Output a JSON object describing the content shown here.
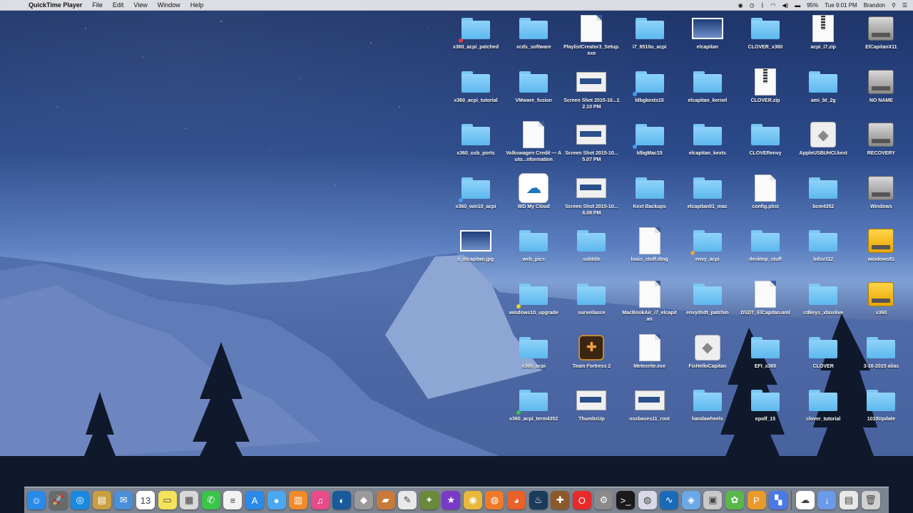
{
  "menubar": {
    "app_name": "QuickTime Player",
    "menus": [
      "File",
      "Edit",
      "View",
      "Window",
      "Help"
    ],
    "battery": "95%",
    "clock": "Tue 9:01 PM",
    "user": "Brandon"
  },
  "desktop": {
    "icons": [
      {
        "label": "x360_acpi_patched",
        "type": "folder",
        "col": 0,
        "row": 0,
        "tag": "#e43b3b"
      },
      {
        "label": "x360_acpi_tutorial",
        "type": "folder",
        "col": 0,
        "row": 1
      },
      {
        "label": "x360_usb_ports",
        "type": "folder",
        "col": 0,
        "row": 2
      },
      {
        "label": "x360_win10_acpi",
        "type": "folder",
        "col": 0,
        "row": 3,
        "tag": "#4a9ae8"
      },
      {
        "label": "z_elcapitan.jpg",
        "type": "shot-dark",
        "col": 0,
        "row": 4
      },
      {
        "label": "xcds_software",
        "type": "folder",
        "col": 1,
        "row": 0
      },
      {
        "label": "VMware_fusion",
        "type": "folder",
        "col": 1,
        "row": 1
      },
      {
        "label": "Volkswagen Credit — Auto...nformation",
        "type": "doc",
        "col": 1,
        "row": 2
      },
      {
        "label": "WD My Cloud",
        "type": "cloud",
        "col": 1,
        "row": 3
      },
      {
        "label": "web_pics",
        "type": "folder",
        "col": 1,
        "row": 4
      },
      {
        "label": "windows10_upgrade",
        "type": "folder",
        "col": 1,
        "row": 5,
        "tag": "#e8d23b"
      },
      {
        "label": "x360_acpi",
        "type": "folder",
        "col": 1,
        "row": 6
      },
      {
        "label": "x360_acpi_term4352",
        "type": "folder",
        "col": 1,
        "row": 7,
        "tag": "#3bc44a"
      },
      {
        "label": "PlaylistCreator3_Setup.exe",
        "type": "doc",
        "col": 2,
        "row": 0
      },
      {
        "label": "Screen Shot 2015-10...12.10 PM",
        "type": "shot",
        "col": 2,
        "row": 1
      },
      {
        "label": "Screen Shot 2015-10...5.07 PM",
        "type": "shot",
        "col": 2,
        "row": 2
      },
      {
        "label": "Screen Shot 2015-10...6.08 PM",
        "type": "shot",
        "col": 2,
        "row": 3
      },
      {
        "label": "subtitle",
        "type": "folder",
        "col": 2,
        "row": 4
      },
      {
        "label": "surveilance",
        "type": "folder",
        "col": 2,
        "row": 5
      },
      {
        "label": "Team Fortress 2",
        "type": "tf2",
        "col": 2,
        "row": 6
      },
      {
        "label": "ThumbsUp",
        "type": "shot",
        "col": 2,
        "row": 7
      },
      {
        "label": "i7_6510u_acpi",
        "type": "folder",
        "col": 3,
        "row": 0
      },
      {
        "label": "ldbgkexts15",
        "type": "folder",
        "col": 3,
        "row": 1,
        "tag": "#4a9ae8"
      },
      {
        "label": "ldbgMac15",
        "type": "folder",
        "col": 3,
        "row": 2,
        "tag": "#4a9ae8"
      },
      {
        "label": "Kext Backups",
        "type": "folder",
        "col": 3,
        "row": 3
      },
      {
        "label": "louis_stuff.dmg",
        "type": "doc",
        "col": 3,
        "row": 4
      },
      {
        "label": "MacBookAir_i7_elcapitan",
        "type": "doc",
        "col": 3,
        "row": 5
      },
      {
        "label": "Meteorite.exe",
        "type": "doc",
        "col": 3,
        "row": 6
      },
      {
        "label": "osxbases11_root",
        "type": "shot",
        "col": 3,
        "row": 7
      },
      {
        "label": "elcapitan",
        "type": "shot-dark",
        "col": 4,
        "row": 0
      },
      {
        "label": "elcapitan_kernel",
        "type": "folder",
        "col": 4,
        "row": 1
      },
      {
        "label": "elcapitan_kexts",
        "type": "folder",
        "col": 4,
        "row": 2
      },
      {
        "label": "elcapitan01_mac",
        "type": "folder",
        "col": 4,
        "row": 3
      },
      {
        "label": "envy_acpi",
        "type": "folder",
        "col": 4,
        "row": 4,
        "tag": "#e8a53b"
      },
      {
        "label": "envydsdt_patchin",
        "type": "folder",
        "col": 4,
        "row": 5
      },
      {
        "label": "FixHelloCapitan",
        "type": "pkg",
        "col": 4,
        "row": 6
      },
      {
        "label": "handawheels",
        "type": "folder",
        "col": 4,
        "row": 7
      },
      {
        "label": "CLOVER_x360",
        "type": "folder",
        "col": 5,
        "row": 0
      },
      {
        "label": "CLOVER.zip",
        "type": "zip",
        "col": 5,
        "row": 1
      },
      {
        "label": "CLOVERenvy",
        "type": "folder",
        "col": 5,
        "row": 2
      },
      {
        "label": "config.plist",
        "type": "doc",
        "col": 5,
        "row": 3
      },
      {
        "label": "desktop_stuff",
        "type": "folder",
        "col": 5,
        "row": 4
      },
      {
        "label": "DSDT_ElCapitan.aml",
        "type": "doc",
        "col": 5,
        "row": 5
      },
      {
        "label": "EFI_x360",
        "type": "folder",
        "col": 5,
        "row": 6
      },
      {
        "label": "epolf_15",
        "type": "folder",
        "col": 5,
        "row": 7
      },
      {
        "label": "acpi_i7.zip",
        "type": "zip",
        "col": 6,
        "row": 0
      },
      {
        "label": "ami_bt_2g",
        "type": "folder",
        "col": 6,
        "row": 1
      },
      {
        "label": "AppleUSBUHCI.kext",
        "type": "pkg",
        "col": 6,
        "row": 2
      },
      {
        "label": "bcm4352",
        "type": "folder",
        "col": 6,
        "row": 3
      },
      {
        "label": "bdsv312",
        "type": "folder",
        "col": 6,
        "row": 4
      },
      {
        "label": "cdkeys_xboxlive",
        "type": "folder",
        "col": 6,
        "row": 5
      },
      {
        "label": "CLOVER",
        "type": "folder",
        "col": 6,
        "row": 6
      },
      {
        "label": "clover_tutorial",
        "type": "folder",
        "col": 6,
        "row": 7
      },
      {
        "label": "ElCapitanX11",
        "type": "disk",
        "col": 7,
        "row": 0
      },
      {
        "label": "NO NAME",
        "type": "disk",
        "col": 7,
        "row": 1
      },
      {
        "label": "RECOVERY",
        "type": "disk",
        "col": 7,
        "row": 2
      },
      {
        "label": "Windows",
        "type": "disk",
        "col": 7,
        "row": 3
      },
      {
        "label": "windows81",
        "type": "disk-yellow",
        "col": 7,
        "row": 4
      },
      {
        "label": "x360",
        "type": "disk-yellow",
        "col": 7,
        "row": 5
      },
      {
        "label": "3-16-2015 alias",
        "type": "folder",
        "col": 7,
        "row": 6
      },
      {
        "label": "1010Update",
        "type": "folder",
        "col": 7,
        "row": 7
      }
    ]
  },
  "dock": {
    "items": [
      {
        "name": "finder-icon",
        "color": "#2a8ae8",
        "glyph": "☺"
      },
      {
        "name": "launchpad-icon",
        "color": "#6a6a6a",
        "glyph": "🚀"
      },
      {
        "name": "safari-icon",
        "color": "#1a8ae0",
        "glyph": "◎"
      },
      {
        "name": "notes-app-icon",
        "color": "#c8a040",
        "glyph": "▤"
      },
      {
        "name": "mail-icon",
        "color": "#4a90d8",
        "glyph": "✉"
      },
      {
        "name": "calendar-icon",
        "color": "#ffffff",
        "glyph": "13"
      },
      {
        "name": "stickies-icon",
        "color": "#f4e25a",
        "glyph": "▭"
      },
      {
        "name": "preview-icon",
        "color": "#d8d8d8",
        "glyph": "▦"
      },
      {
        "name": "messages-icon",
        "color": "#3ac44a",
        "glyph": "✆"
      },
      {
        "name": "textedit-icon",
        "color": "#f2f2f2",
        "glyph": "≡"
      },
      {
        "name": "appstore-icon",
        "color": "#2a8ae8",
        "glyph": "A"
      },
      {
        "name": "messenger-icon",
        "color": "#4aa8f0",
        "glyph": "●"
      },
      {
        "name": "ibooks-icon",
        "color": "#f08a2a",
        "glyph": "▥"
      },
      {
        "name": "itunes-icon",
        "color": "#e84a8a",
        "glyph": "♫"
      },
      {
        "name": "browser-icon",
        "color": "#1a5a9a",
        "glyph": "◐"
      },
      {
        "name": "app-icon",
        "color": "#9a9a9a",
        "glyph": "◆"
      },
      {
        "name": "app-icon",
        "color": "#c87a3a",
        "glyph": "▰"
      },
      {
        "name": "script-icon",
        "color": "#e8e8e8",
        "glyph": "✎"
      },
      {
        "name": "app-icon",
        "color": "#6a8a3a",
        "glyph": "✦"
      },
      {
        "name": "imovie-icon",
        "color": "#7a3ac8",
        "glyph": "★"
      },
      {
        "name": "chrome-icon",
        "color": "#e8b83a",
        "glyph": "◉"
      },
      {
        "name": "app-icon",
        "color": "#f07a2a",
        "glyph": "◍"
      },
      {
        "name": "firefox-icon",
        "color": "#e8602a",
        "glyph": "◕"
      },
      {
        "name": "steam-icon",
        "color": "#1a3a5a",
        "glyph": "♨"
      },
      {
        "name": "tf2-icon",
        "color": "#8a5a2a",
        "glyph": "✚"
      },
      {
        "name": "opera-icon",
        "color": "#e82a2a",
        "glyph": "O"
      },
      {
        "name": "system-preferences-icon",
        "color": "#8a8a8a",
        "glyph": "⚙"
      },
      {
        "name": "terminal-icon",
        "color": "#1a1a1a",
        "glyph": ">_"
      },
      {
        "name": "utility-icon",
        "color": "#d8d8e8",
        "glyph": "◍"
      },
      {
        "name": "activity-monitor-icon",
        "color": "#1a6ab8",
        "glyph": "∿"
      },
      {
        "name": "network-icon",
        "color": "#6aa8e8",
        "glyph": "◈"
      },
      {
        "name": "app-icon",
        "color": "#c8c8c8",
        "glyph": "▣"
      },
      {
        "name": "app-icon",
        "color": "#5ab84a",
        "glyph": "✿"
      },
      {
        "name": "app-icon",
        "color": "#e89a2a",
        "glyph": "P"
      },
      {
        "name": "app-icon",
        "color": "#4a7ae8",
        "glyph": "▚"
      },
      {
        "name": "wd-cloud-icon",
        "color": "#ffffff",
        "glyph": "☁"
      },
      {
        "name": "downloads-icon",
        "color": "#6a9ae8",
        "glyph": "↓"
      },
      {
        "name": "documents-icon",
        "color": "#e8e8e8",
        "glyph": "▤"
      },
      {
        "name": "trash-icon",
        "color": "#d0d0d0",
        "glyph": "🗑"
      }
    ]
  }
}
